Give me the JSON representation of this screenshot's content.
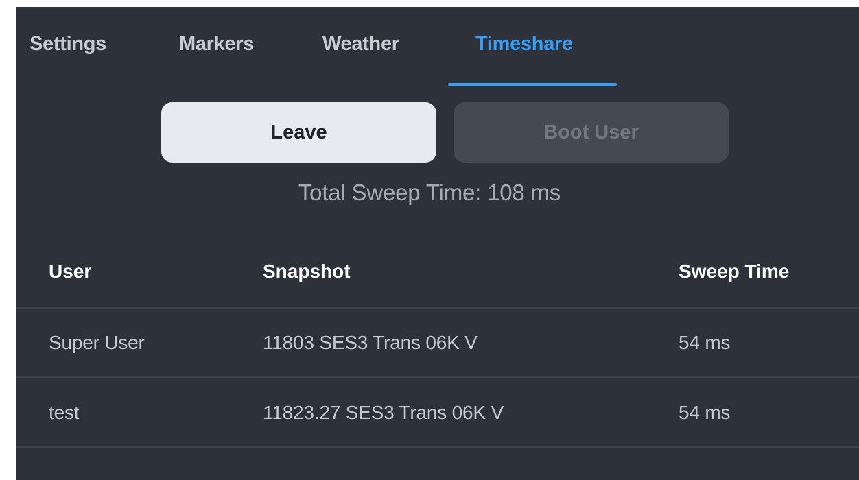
{
  "tabs": [
    {
      "label": "Settings",
      "active": false
    },
    {
      "label": "Markers",
      "active": false
    },
    {
      "label": "Weather",
      "active": false
    },
    {
      "label": "Timeshare",
      "active": true
    }
  ],
  "actions": {
    "leave_label": "Leave",
    "boot_user_label": "Boot User",
    "boot_user_disabled": true
  },
  "summary": {
    "label": "Total Sweep Time:",
    "value": "108 ms"
  },
  "table": {
    "headers": {
      "user": "User",
      "snapshot": "Snapshot",
      "sweep_time": "Sweep Time"
    },
    "rows": [
      {
        "user": "Super User",
        "snapshot": "11803 SES3 Trans 06K V",
        "sweep_time": "54 ms"
      },
      {
        "user": "test",
        "snapshot": "11823.27 SES3 Trans 06K V",
        "sweep_time": "54 ms"
      }
    ]
  },
  "colors": {
    "background": "#2c313a",
    "accent": "#3d9bf2",
    "primary_button": "#e8eaef",
    "disabled_button": "#454a52"
  }
}
